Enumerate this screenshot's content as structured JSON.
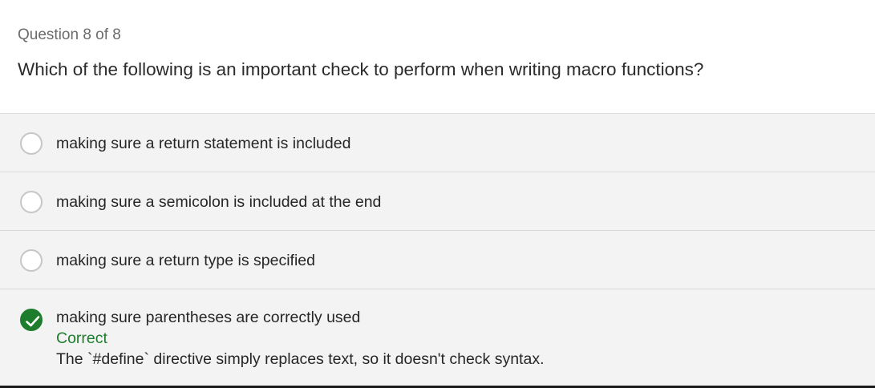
{
  "quiz": {
    "counter": "Question 8 of 8",
    "question": "Which of the following is an important check to perform when writing macro functions?"
  },
  "options": [
    {
      "label": "making sure a return statement is included",
      "selected": false
    },
    {
      "label": "making sure a semicolon is included at the end",
      "selected": false
    },
    {
      "label": "making sure a return type is specified",
      "selected": false
    },
    {
      "label": "making sure parentheses are correctly used",
      "selected": true
    }
  ],
  "feedback": {
    "status": "Correct",
    "explanation": "The `#define` directive simply replaces text, so it doesn't check syntax."
  },
  "colors": {
    "correct": "#1e7d2c",
    "options_bg": "#f3f3f3"
  },
  "icons": {
    "selected_option": "check-icon"
  }
}
